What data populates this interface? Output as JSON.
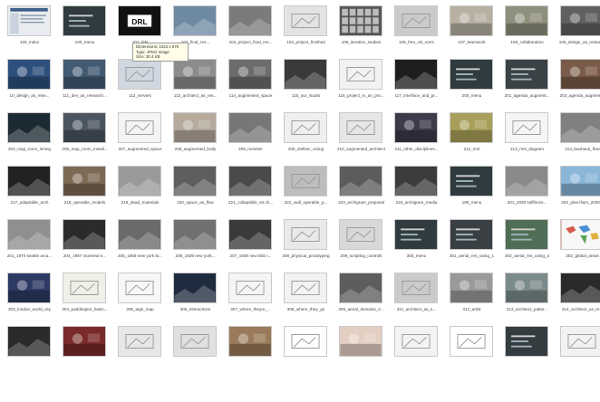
{
  "files": [
    {
      "name": "100_index",
      "thumb": "#e8ecf0",
      "kind": "page"
    },
    {
      "name": "100_menu",
      "thumb": "#2f3b3e",
      "kind": "menu"
    },
    {
      "name": "101_title",
      "thumb": "#111111",
      "kind": "logo",
      "logo": "DRL"
    },
    {
      "name": "102_final_res...",
      "thumb": "#6d8aa2",
      "kind": "dark"
    },
    {
      "name": "102_project_final_res...",
      "thumb": "#7b7b7b",
      "kind": "dark"
    },
    {
      "name": "104_project_finished",
      "thumb": "#e3e3e3",
      "kind": "light"
    },
    {
      "name": "105_iterative_studies",
      "thumb": "#575757",
      "kind": "grid"
    },
    {
      "name": "106_thru_vis_vorm",
      "thumb": "#cbcbcb",
      "kind": "light"
    },
    {
      "name": "107_teamwork",
      "thumb": "#b7b0a3",
      "kind": "photo"
    },
    {
      "name": "108_collaboration",
      "thumb": "#8f8f7d",
      "kind": "photo"
    },
    {
      "name": "109_design_as_research",
      "thumb": "#606060",
      "kind": "photo"
    },
    {
      "name": "10_design_as_rese...",
      "thumb": "#2d4f7c",
      "kind": "photo"
    },
    {
      "name": "111_dev_as_research...",
      "thumb": "#425a72",
      "kind": "photo"
    },
    {
      "name": "112_servers",
      "thumb": "#d0d7e0",
      "kind": "light"
    },
    {
      "name": "113_architect_as_res...",
      "thumb": "#8c8c8c",
      "kind": "photo"
    },
    {
      "name": "114_augmented_space",
      "thumb": "#6c6c6c",
      "kind": "photo"
    },
    {
      "name": "115_our_studio",
      "thumb": "#3a3a3a",
      "kind": "dark"
    },
    {
      "name": "116_project_in_an_pro...",
      "thumb": "#f2f2f2",
      "kind": "light"
    },
    {
      "name": "117_interface_and_pr...",
      "thumb": "#1e1e1e",
      "kind": "dark"
    },
    {
      "name": "200_menu",
      "thumb": "#2f3b3e",
      "kind": "menu"
    },
    {
      "name": "201_agenda_augment...",
      "thumb": "#3a4245",
      "kind": "menu"
    },
    {
      "name": "202_agenda_augment...",
      "thumb": "#7a5a48",
      "kind": "photo"
    },
    {
      "name": "204_map_room_inning",
      "thumb": "#1b2a33",
      "kind": "dark"
    },
    {
      "name": "205_map_room_install...",
      "thumb": "#4a5560",
      "kind": "photo"
    },
    {
      "name": "207_augmented_space",
      "thumb": "#f4f4f4",
      "kind": "light"
    },
    {
      "name": "208_augmented_body",
      "thumb": "#b5aa9c",
      "kind": "photo"
    },
    {
      "name": "209_monster",
      "thumb": "#777777",
      "kind": "dark"
    },
    {
      "name": "20b_stellarc_vining",
      "thumb": "#efefef",
      "kind": "light"
    },
    {
      "name": "210_augmented_architect",
      "thumb": "#e6e6e6",
      "kind": "light"
    },
    {
      "name": "211_other_disciplines...",
      "thumb": "#3b3b4a",
      "kind": "photo"
    },
    {
      "name": "212_mrs",
      "thumb": "#a8a05a",
      "kind": "photo"
    },
    {
      "name": "213_mrs_diagram",
      "thumb": "#f5f5f5",
      "kind": "light"
    },
    {
      "name": "214_bauhaus_flow",
      "thumb": "#808080",
      "kind": "dark"
    },
    {
      "name": "217_adaptable_arch",
      "thumb": "#222222",
      "kind": "dark"
    },
    {
      "name": "218_operable_models",
      "thumb": "#7d6a55",
      "kind": "photo"
    },
    {
      "name": "219_dead_materials",
      "thumb": "#9a9a9a",
      "kind": "dark"
    },
    {
      "name": "220_space_as_flow",
      "thumb": "#5e5e5e",
      "kind": "dark"
    },
    {
      "name": "221_collapsible_str.ch...",
      "thumb": "#4a4a4a",
      "kind": "dark"
    },
    {
      "name": "222_wall_operable_p...",
      "thumb": "#bdbdbd",
      "kind": "light"
    },
    {
      "name": "223_archigram_proposal",
      "thumb": "#5c5c5c",
      "kind": "dark"
    },
    {
      "name": "224_archigram_media",
      "thumb": "#3c3c3c",
      "kind": "dark"
    },
    {
      "name": "190_menu",
      "thumb": "#2f3b3e",
      "kind": "menu"
    },
    {
      "name": "201_2030 selfforcis...",
      "thumb": "#8a8a8a",
      "kind": "dark"
    },
    {
      "name": "202_plas-ifium_2030...",
      "thumb": "#8ab6d8",
      "kind": "photo"
    },
    {
      "name": "201_1970 seattle arca...",
      "thumb": "#8f8f8f",
      "kind": "dark"
    },
    {
      "name": "204_1967 montreal e...",
      "thumb": "#2b2b2b",
      "kind": "dark"
    },
    {
      "name": "205_1959 new york fa...",
      "thumb": "#6a6a6a",
      "kind": "dark"
    },
    {
      "name": "206_1939 new york...",
      "thumb": "#707070",
      "kind": "dark"
    },
    {
      "name": "207_1939 new blitz r...",
      "thumb": "#3a3a3a",
      "kind": "dark"
    },
    {
      "name": "208_physical_prototyping",
      "thumb": "#e9e9e9",
      "kind": "light"
    },
    {
      "name": "209_scripting_controls",
      "thumb": "#d8d8d8",
      "kind": "light"
    },
    {
      "name": "300_menu",
      "thumb": "#2f3b3e",
      "kind": "menu"
    },
    {
      "name": "301_aerial_res_using_1",
      "thumb": "#3a3f44",
      "kind": "menu"
    },
    {
      "name": "302_aerial_res_using_2",
      "thumb": "#4f6e55",
      "kind": "menu"
    },
    {
      "name": "302_global_areas",
      "thumb": "#d65a4a",
      "kind": "map"
    },
    {
      "name": "303_london_world_city",
      "thumb": "#2d3a63",
      "kind": "photo"
    },
    {
      "name": "304_paddington_basin...",
      "thumb": "#f0efe8",
      "kind": "light"
    },
    {
      "name": "305_tags_map",
      "thumb": "#f7f7f7",
      "kind": "light"
    },
    {
      "name": "306_interactions",
      "thumb": "#1f2c3f",
      "kind": "dark"
    },
    {
      "name": "307_where_theyre_...",
      "thumb": "#f5f5f5",
      "kind": "light"
    },
    {
      "name": "308_where_they_go",
      "thumb": "#f2f2f2",
      "kind": "light"
    },
    {
      "name": "309_aerial_domains_2...",
      "thumb": "#5d5d5d",
      "kind": "dark"
    },
    {
      "name": "311_architect_as_s...",
      "thumb": "#cbcbcb",
      "kind": "light"
    },
    {
      "name": "312_artist",
      "thumb": "#9a9a9a",
      "kind": "photo"
    },
    {
      "name": "313_architect_patter...",
      "thumb": "#7b8b8b",
      "kind": "photo"
    },
    {
      "name": "314_architect_as_te...",
      "thumb": "#2a2a2a",
      "kind": "dark"
    },
    {
      "name": "",
      "thumb": "#2a2a2a",
      "kind": "dark"
    },
    {
      "name": "",
      "thumb": "#7a2a2a",
      "kind": "photo"
    },
    {
      "name": "",
      "thumb": "#e7e7e7",
      "kind": "light"
    },
    {
      "name": "",
      "thumb": "#e0e0e0",
      "kind": "light"
    },
    {
      "name": "",
      "thumb": "#9a7a5a",
      "kind": "photo"
    },
    {
      "name": "",
      "thumb": "#ffffff",
      "kind": "light"
    },
    {
      "name": "",
      "thumb": "#e2cfc2",
      "kind": "photo"
    },
    {
      "name": "",
      "thumb": "#f3f3f3",
      "kind": "light"
    },
    {
      "name": "",
      "thumb": "#ffffff",
      "kind": "light"
    },
    {
      "name": "",
      "thumb": "#353c40",
      "kind": "menu"
    },
    {
      "name": "",
      "thumb": "#f2f2f2",
      "kind": "light"
    }
  ],
  "tooltip": {
    "dimensions": "Dimensions: 1024 x 576",
    "type": "Type: JPEG Image",
    "size": "Size: 30.4 KB"
  }
}
